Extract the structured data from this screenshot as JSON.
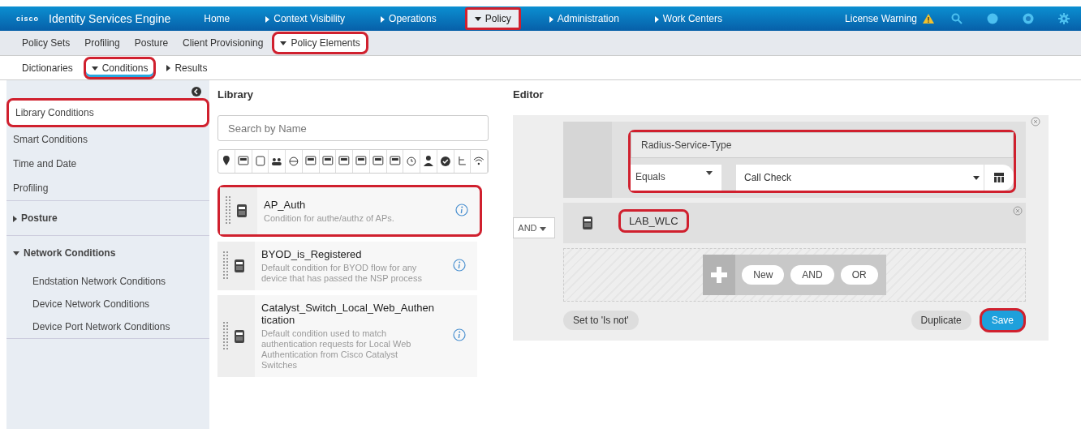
{
  "header": {
    "logo": "cisco",
    "product": "Identity Services Engine",
    "nav": [
      {
        "label": "Home",
        "kind": "link",
        "selected": false,
        "circled": false
      },
      {
        "label": "Context Visibility",
        "kind": "menu",
        "selected": false,
        "circled": false
      },
      {
        "label": "Operations",
        "kind": "menu",
        "selected": false,
        "circled": false
      },
      {
        "label": "Policy",
        "kind": "menu",
        "selected": true,
        "circled": true
      },
      {
        "label": "Administration",
        "kind": "menu",
        "selected": false,
        "circled": false
      },
      {
        "label": "Work Centers",
        "kind": "menu",
        "selected": false,
        "circled": false
      }
    ],
    "license_warning": "License Warning"
  },
  "subnav": [
    {
      "label": "Policy Sets",
      "kind": "link",
      "selected": false,
      "circled": false
    },
    {
      "label": "Profiling",
      "kind": "link",
      "selected": false,
      "circled": false
    },
    {
      "label": "Posture",
      "kind": "link",
      "selected": false,
      "circled": false
    },
    {
      "label": "Client Provisioning",
      "kind": "link",
      "selected": false,
      "circled": false
    },
    {
      "label": "Policy Elements",
      "kind": "menu",
      "selected": true,
      "circled": true
    }
  ],
  "tabs": [
    {
      "label": "Dictionaries",
      "kind": "link",
      "selected": false,
      "circled": false
    },
    {
      "label": "Conditions",
      "kind": "menu",
      "selected": true,
      "circled": true
    },
    {
      "label": "Results",
      "kind": "menu",
      "selected": false,
      "circled": false
    }
  ],
  "sidebar": {
    "items": [
      {
        "label": "Library Conditions",
        "selected": true,
        "circled": true
      },
      {
        "label": "Smart Conditions",
        "selected": false,
        "circled": false
      },
      {
        "label": "Time and Date",
        "selected": false,
        "circled": false
      },
      {
        "label": "Profiling",
        "selected": false,
        "circled": false
      }
    ],
    "groups": [
      {
        "label": "Posture",
        "expanded": false
      },
      {
        "label": "Network Conditions",
        "expanded": true,
        "children": [
          {
            "label": "Endstation Network Conditions"
          },
          {
            "label": "Device Network Conditions"
          },
          {
            "label": "Device Port Network Conditions"
          }
        ]
      }
    ]
  },
  "library": {
    "title": "Library",
    "search": {
      "placeholder": "Search by Name"
    },
    "conditions": [
      {
        "name": "AP_Auth",
        "description": "Condition for authe/authz of APs.",
        "circled": true
      },
      {
        "name": "BYOD_is_Registered",
        "description": "Default condition for BYOD flow for any device that has passed the NSP process",
        "circled": false
      },
      {
        "name": "Catalyst_Switch_Local_Web_Authentication",
        "description": "Default condition used to match authentication requests for Local Web Authentication from Cisco Catalyst Switches",
        "circled": false
      }
    ]
  },
  "editor": {
    "title": "Editor",
    "operator": "AND",
    "rule": {
      "attribute": "Radius-Service-Type",
      "comparison": "Equals",
      "value": "Call Check",
      "circled": true
    },
    "library_condition": {
      "name": "LAB_WLC",
      "circled": true
    },
    "add_buttons": [
      "New",
      "AND",
      "OR"
    ],
    "set_not": "Set to 'Is not'",
    "duplicate": "Duplicate",
    "save": {
      "label": "Save",
      "circled": true
    }
  }
}
